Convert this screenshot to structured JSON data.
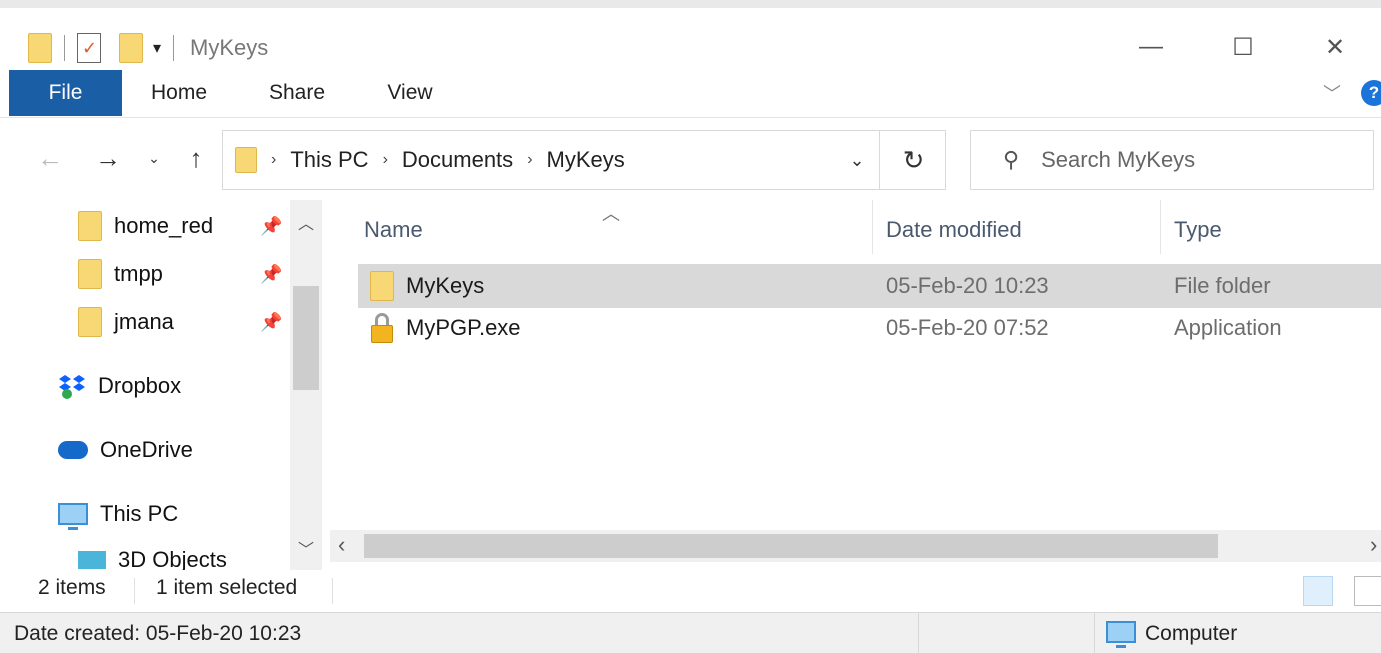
{
  "window": {
    "title": "MyKeys",
    "controls": {
      "minimize": "—",
      "maximize": "☐",
      "close": "✕"
    }
  },
  "ribbon": {
    "tabs": [
      "File",
      "Home",
      "Share",
      "View"
    ],
    "help": "?"
  },
  "navigation": {
    "breadcrumb": [
      "This PC",
      "Documents",
      "MyKeys"
    ],
    "search_placeholder": "Search MyKeys"
  },
  "nav_pane": {
    "quick_access": [
      {
        "label": "home_red",
        "icon": "folder-icon",
        "pinned": true
      },
      {
        "label": "tmpp",
        "icon": "folder-icon",
        "pinned": true
      },
      {
        "label": "jmana",
        "icon": "folder-icon",
        "pinned": true
      }
    ],
    "locations": [
      {
        "label": "Dropbox",
        "icon": "dropbox-icon"
      },
      {
        "label": "OneDrive",
        "icon": "onedrive-icon"
      },
      {
        "label": "This PC",
        "icon": "this-pc-icon"
      },
      {
        "label": "3D Objects",
        "icon": "3d-objects-icon"
      }
    ]
  },
  "file_list": {
    "columns": [
      "Name",
      "Date modified",
      "Type"
    ],
    "rows": [
      {
        "name": "MyKeys",
        "date": "05-Feb-20 10:23",
        "type": "File folder",
        "icon": "folder-icon",
        "selected": true
      },
      {
        "name": "MyPGP.exe",
        "date": "05-Feb-20 07:52",
        "type": "Application",
        "icon": "lock-app-icon",
        "selected": false
      }
    ]
  },
  "status": {
    "item_count": "2 items",
    "selection": "1 item selected"
  },
  "details": {
    "date_created": "Date created: 05-Feb-20 10:23",
    "location": "Computer"
  },
  "colors": {
    "file_tab": "#1a5ea6",
    "folder": "#f8d775",
    "selection": "#d9d9d9"
  }
}
